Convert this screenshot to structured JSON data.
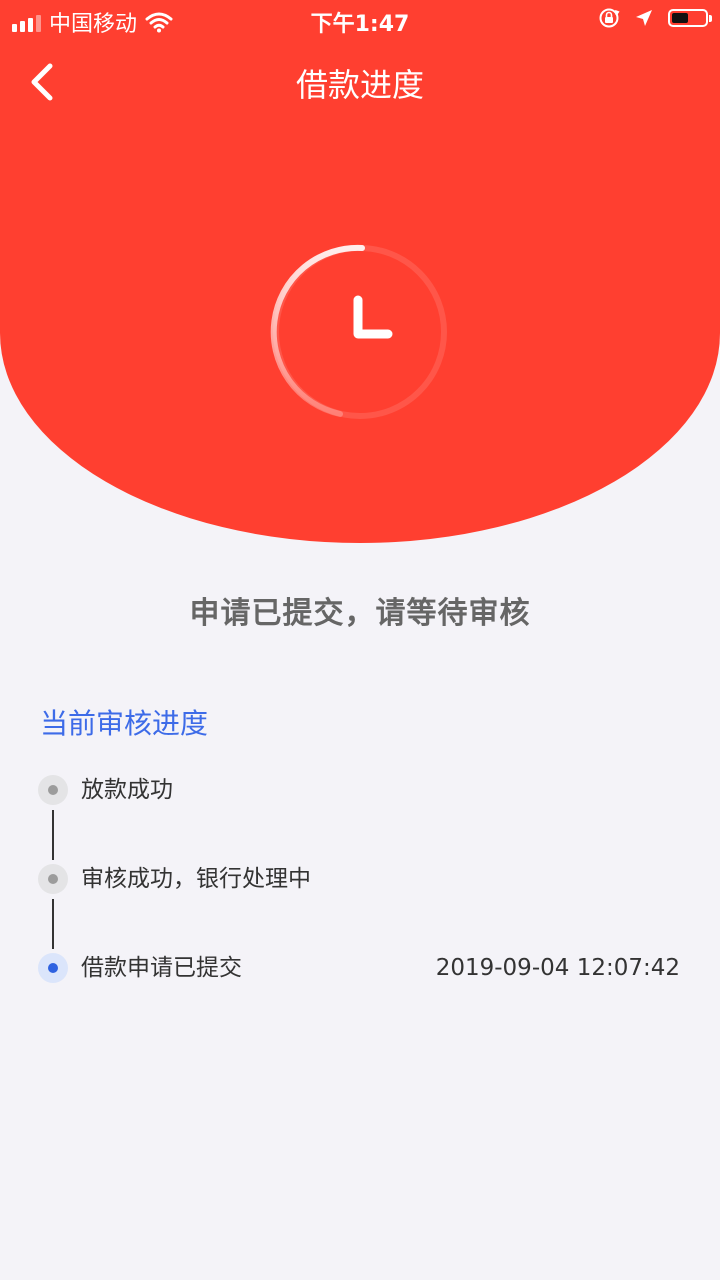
{
  "status_bar": {
    "carrier": "中国移动",
    "time": "下午1:47",
    "icons": [
      "signal-icon",
      "wifi-icon",
      "rotation-lock-icon",
      "location-arrow-icon",
      "battery-icon"
    ]
  },
  "nav": {
    "back_icon": "chevron-left-icon",
    "title": "借款进度"
  },
  "hero": {
    "icon": "clock-icon",
    "background_color": "#ff3f30"
  },
  "status_message": "申请已提交，请等待审核",
  "progress": {
    "title": "当前审核进度",
    "title_color": "#3d6be8",
    "steps": [
      {
        "label": "放款成功",
        "time": "",
        "state": "pending"
      },
      {
        "label": "审核成功，银行处理中",
        "time": "",
        "state": "pending"
      },
      {
        "label": "借款申请已提交",
        "time": "2019-09-04 12:07:42",
        "state": "current"
      }
    ]
  }
}
